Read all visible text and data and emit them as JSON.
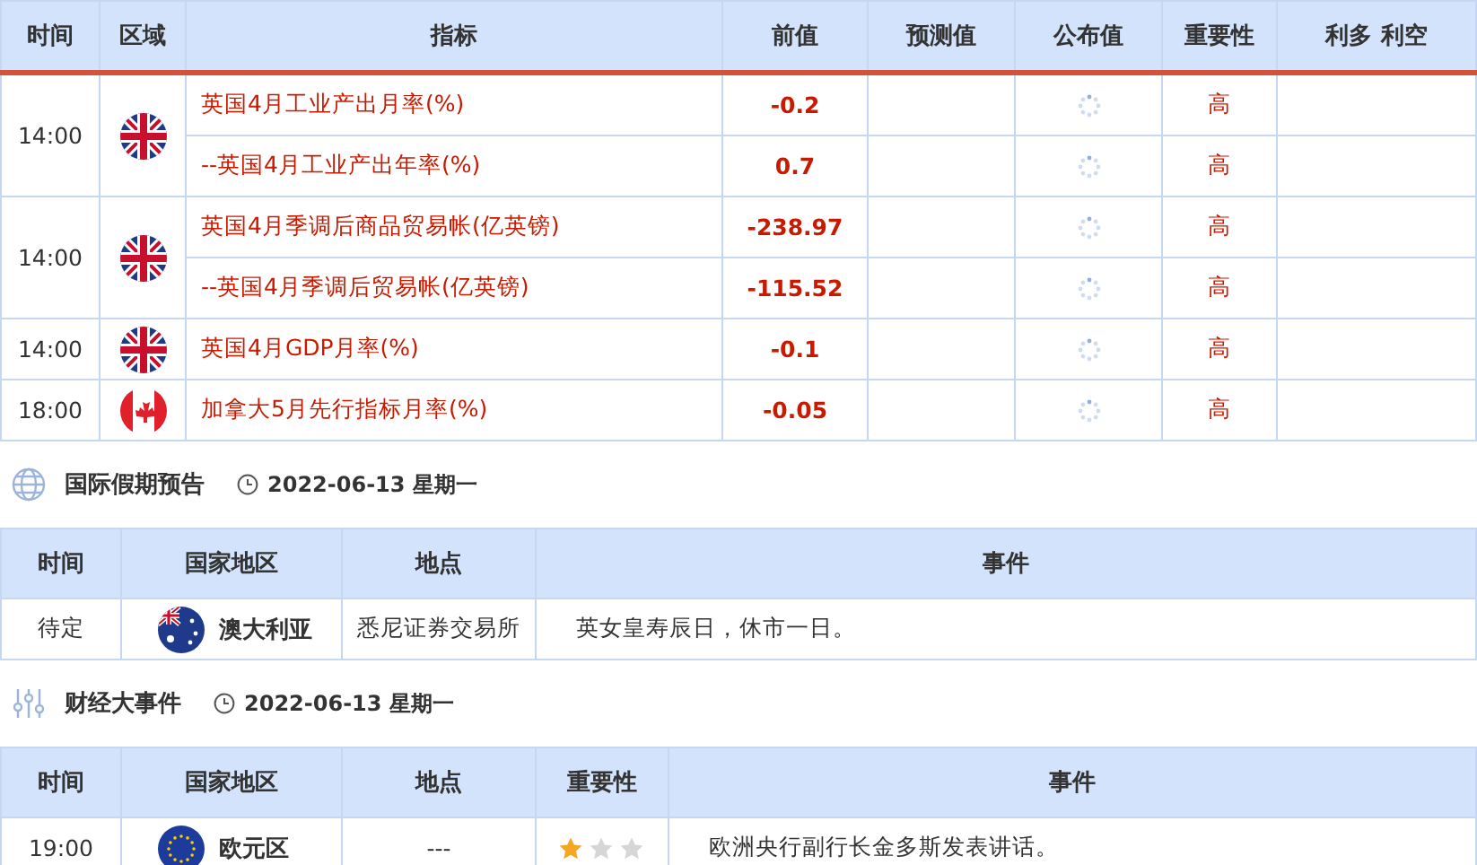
{
  "calendar": {
    "columns": [
      "时间",
      "区域",
      "指标",
      "前值",
      "预测值",
      "公布值",
      "重要性",
      "利多 利空"
    ],
    "groups": [
      {
        "time": "14:00",
        "kind": "uk",
        "items": [
          {
            "indicator": "英国4月工业产出月率(%)",
            "previous": "-0.2",
            "importance": "高"
          },
          {
            "indicator": "--英国4月工业产出年率(%)",
            "previous": "0.7",
            "importance": "高"
          }
        ]
      },
      {
        "time": "14:00",
        "kind": "uk",
        "items": [
          {
            "indicator": "英国4月季调后商品贸易帐(亿英镑)",
            "previous": "-238.97",
            "importance": "高"
          },
          {
            "indicator": "--英国4月季调后贸易帐(亿英镑)",
            "previous": "-115.52",
            "importance": "高"
          }
        ]
      },
      {
        "time": "14:00",
        "kind": "uk",
        "items": [
          {
            "indicator": "英国4月GDP月率(%)",
            "previous": "-0.1",
            "importance": "高"
          }
        ]
      },
      {
        "time": "18:00",
        "kind": "ca",
        "items": [
          {
            "indicator": "加拿大5月先行指标月率(%)",
            "previous": "-0.05",
            "importance": "高"
          }
        ]
      }
    ]
  },
  "holidays": {
    "title": "国际假期预告",
    "date": "2022-06-13 星期一",
    "columns": [
      "时间",
      "国家地区",
      "地点",
      "事件"
    ],
    "rows": [
      {
        "time": "待定",
        "kind": "au",
        "country": "澳大利亚",
        "place": "悉尼证券交易所",
        "event": "英女皇寿辰日，休市一日。"
      }
    ]
  },
  "events": {
    "title": "财经大事件",
    "date": "2022-06-13 星期一",
    "columns": [
      "时间",
      "国家地区",
      "地点",
      "重要性",
      "事件"
    ],
    "rows": [
      {
        "time": "19:00",
        "kind": "eu",
        "country": "欧元区",
        "place": "---",
        "stars": 1,
        "event": "欧洲央行副行长金多斯发表讲话。"
      }
    ]
  }
}
